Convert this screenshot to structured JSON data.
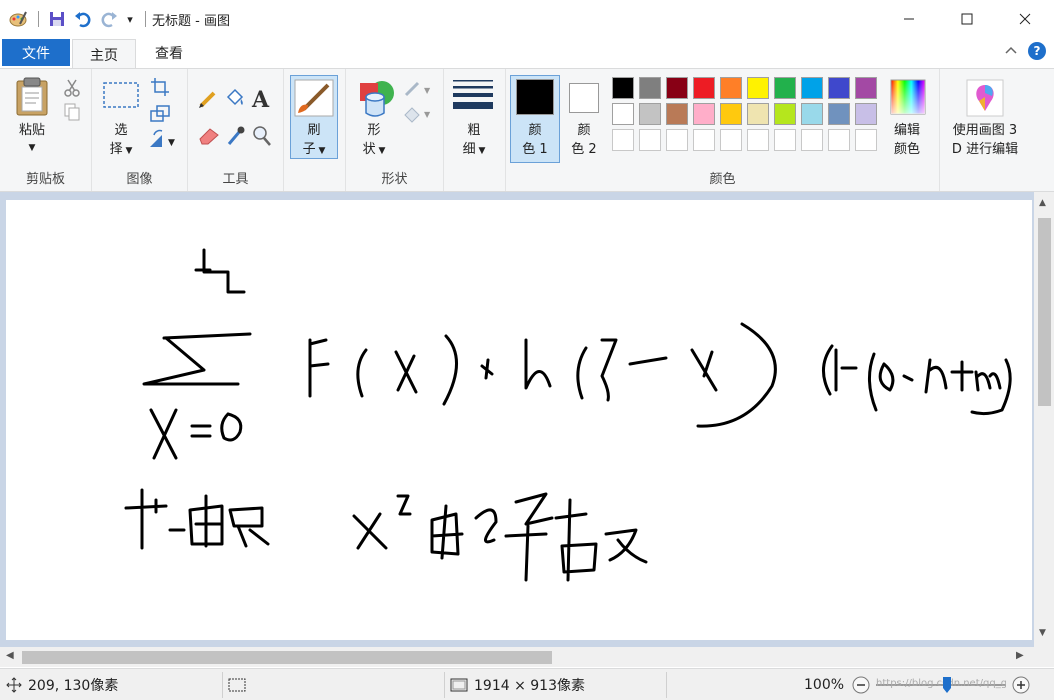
{
  "window": {
    "title": "无标题 - 画图",
    "minimize_glyph": "—",
    "close_glyph": "✕"
  },
  "quick_access": {
    "customize_glyph": "▾"
  },
  "tabs": {
    "file": "文件",
    "home": "主页",
    "view": "查看"
  },
  "ribbon": {
    "clipboard": {
      "group_label": "剪贴板",
      "paste_label": "粘贴"
    },
    "image": {
      "group_label": "图像",
      "select_line1": "选",
      "select_line2": "择"
    },
    "tools": {
      "group_label": "工具",
      "text_glyph": "A"
    },
    "brushes": {
      "line1": "刷",
      "line2": "子"
    },
    "shapes": {
      "group_label": "形状",
      "line1": "形",
      "line2": "状"
    },
    "size": {
      "line1": "粗",
      "line2": "细"
    },
    "colors": {
      "group_label": "颜色",
      "color1_line1": "颜",
      "color1_line2": "色 1",
      "color2_line1": "颜",
      "color2_line2": "色 2",
      "edit_line1": "编辑",
      "edit_line2": "颜色",
      "color1": "#000000",
      "color2": "#ffffff",
      "palette_row1": [
        "#000000",
        "#7f7f7f",
        "#880015",
        "#ed1c24",
        "#ff7f27",
        "#fff200",
        "#22b14c",
        "#00a2e8",
        "#3f48cc",
        "#a349a4"
      ],
      "palette_row2": [
        "#ffffff",
        "#c3c3c3",
        "#b97a57",
        "#ffaec9",
        "#ffc90e",
        "#efe4b0",
        "#b5e61d",
        "#99d9ea",
        "#7092be",
        "#c8bfe7"
      ],
      "palette_row3": [
        "#ffffff",
        "#ffffff",
        "#ffffff",
        "#ffffff",
        "#ffffff",
        "#ffffff",
        "#ffffff",
        "#ffffff",
        "#ffffff",
        "#ffffff"
      ]
    },
    "paint3d": {
      "line1": "使用画图 3",
      "line2": "D 进行编辑"
    }
  },
  "status": {
    "cursor_position": "209, 130像素",
    "canvas_size": "1914 × 913像素",
    "zoom": "100%",
    "watermark": "https://blog.csdn.net/qq_gyi"
  }
}
